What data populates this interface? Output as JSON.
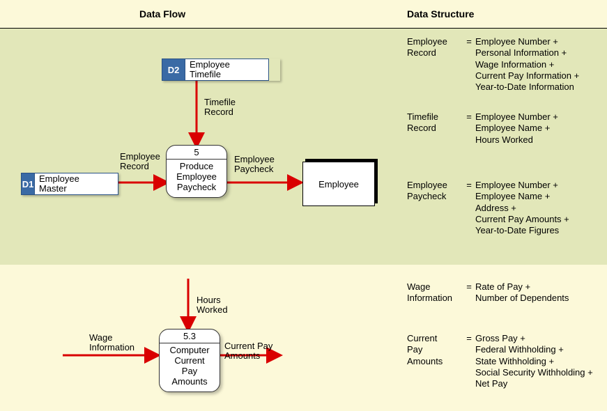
{
  "headers": {
    "dataFlow": "Data Flow",
    "dataStructure": "Data Structure"
  },
  "datastores": {
    "d1": {
      "tag": "D1",
      "label1": "Employee",
      "label2": "Master"
    },
    "d2": {
      "tag": "D2",
      "label1": "Employee",
      "label2": "Timefile"
    }
  },
  "processes": {
    "p5": {
      "num": "5",
      "line1": "Produce",
      "line2": "Employee",
      "line3": "Paycheck",
      "line4": ""
    },
    "p53": {
      "num": "5.3",
      "line1": "Computer",
      "line2": "Current",
      "line3": "Pay",
      "line4": "Amounts"
    }
  },
  "entity": {
    "label": "Employee"
  },
  "flows": {
    "timefileRecord": {
      "l1": "Timefile",
      "l2": "Record"
    },
    "employeeRecord": {
      "l1": "Employee",
      "l2": "Record"
    },
    "employeePaycheck": {
      "l1": "Employee",
      "l2": "Paycheck"
    },
    "hoursWorked": {
      "l1": "Hours",
      "l2": "Worked"
    },
    "wageInformation": {
      "l1": "Wage",
      "l2": "Information"
    },
    "currentPayAmounts": {
      "l1": "Current Pay",
      "l2": "Amounts"
    }
  },
  "structures": {
    "employeeRecord": {
      "nameL1": "Employee",
      "nameL2": "Record",
      "eq": "=",
      "body": "Employee Number +\nPersonal Information +\nWage Information +\nCurrent Pay Information +\nYear-to-Date Information"
    },
    "timefileRecord": {
      "nameL1": "Timefile",
      "nameL2": "Record",
      "eq": "=",
      "body": "Employee Number +\nEmployee Name +\nHours Worked"
    },
    "employeePaycheck": {
      "nameL1": "Employee",
      "nameL2": "Paycheck",
      "eq": "=",
      "body": "Employee Number +\nEmployee Name +\nAddress +\nCurrent Pay Amounts +\nYear-to-Date Figures"
    },
    "wageInformation": {
      "nameL1": "Wage",
      "nameL2": "Information",
      "eq": "=",
      "body": "Rate of Pay +\nNumber of Dependents"
    },
    "currentPayAmounts": {
      "nameL1": "Current",
      "nameL2": "Pay",
      "nameL3": "Amounts",
      "eq": "=",
      "body": "Gross Pay +\nFederal Withholding +\nState Withholding +\nSocial Security Withholding +\nNet Pay"
    }
  }
}
